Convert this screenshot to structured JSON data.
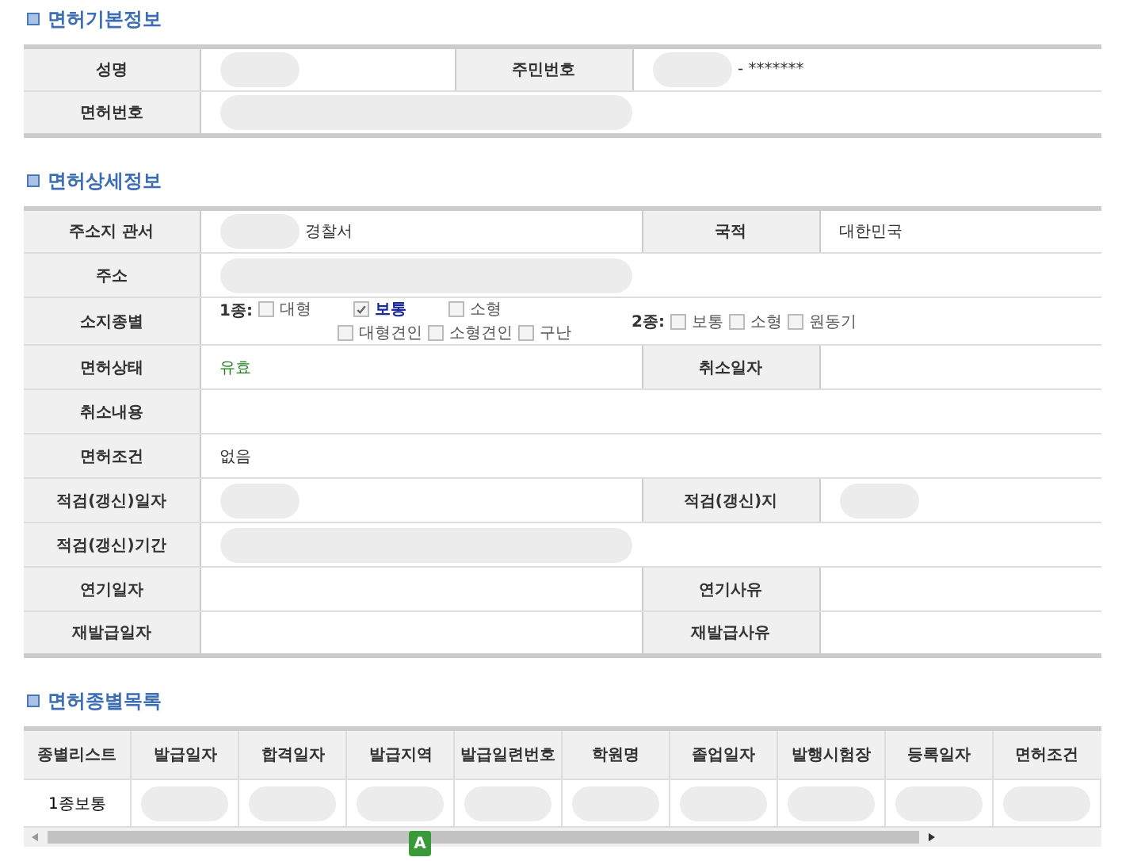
{
  "sections": [
    {
      "title": "면허기본정보",
      "kind": "form",
      "rows": [
        [
          {
            "kind": "label",
            "text": "성명"
          },
          {
            "kind": "value",
            "redacted": true
          },
          {
            "kind": "label",
            "text": "주민번호"
          },
          {
            "kind": "value",
            "text": "- *******",
            "redacted": true
          }
        ],
        [
          {
            "kind": "label",
            "text": "면허번호"
          },
          {
            "kind": "value",
            "redacted": true,
            "colspan": 3
          }
        ]
      ]
    },
    {
      "title": "면허상세정보",
      "kind": "form",
      "rows": [
        [
          {
            "kind": "label",
            "text": "주소지 관서"
          },
          {
            "kind": "value",
            "text": "경찰서",
            "redacted": true
          },
          {
            "kind": "label",
            "text": "국적"
          },
          {
            "kind": "value",
            "text": "대한민국"
          }
        ],
        [
          {
            "kind": "label",
            "text": "주소"
          },
          {
            "kind": "value",
            "redacted": true,
            "colspan": 3
          }
        ],
        [
          {
            "kind": "label",
            "text": "소지종별"
          },
          {
            "kind": "checks",
            "colspan": 3,
            "groups": [
              {
                "label": "1종:",
                "items": [
                  {
                    "text": "대형",
                    "checked": false
                  },
                  {
                    "text": "보통",
                    "checked": true
                  },
                  {
                    "text": "소형",
                    "checked": false
                  },
                  {
                    "text": "대형견인",
                    "checked": false
                  },
                  {
                    "text": "소형견인",
                    "checked": false
                  },
                  {
                    "text": "구난",
                    "checked": false
                  }
                ]
              },
              {
                "label": "2종:",
                "items": [
                  {
                    "text": "보통",
                    "checked": false
                  },
                  {
                    "text": "소형",
                    "checked": false
                  },
                  {
                    "text": "원동기",
                    "checked": false
                  }
                ]
              }
            ]
          }
        ],
        [
          {
            "kind": "label",
            "text": "면허상태"
          },
          {
            "kind": "status",
            "text": "유효"
          },
          {
            "kind": "label",
            "text": "취소일자"
          },
          {
            "kind": "value"
          }
        ],
        [
          {
            "kind": "label",
            "text": "취소내용"
          },
          {
            "kind": "value",
            "colspan": 3
          }
        ],
        [
          {
            "kind": "label",
            "text": "면허조건"
          },
          {
            "kind": "value",
            "text": "없음",
            "colspan": 3
          }
        ],
        [
          {
            "kind": "label",
            "text": "적검(갱신)일자"
          },
          {
            "kind": "value",
            "redacted": true
          },
          {
            "kind": "label",
            "text": "적검(갱신)지"
          },
          {
            "kind": "value",
            "redacted": true
          }
        ],
        [
          {
            "kind": "label",
            "text": "적검(갱신)기간"
          },
          {
            "kind": "value",
            "redacted": true,
            "colspan": 3
          }
        ],
        [
          {
            "kind": "label",
            "text": "연기일자"
          },
          {
            "kind": "value"
          },
          {
            "kind": "label",
            "text": "연기사유"
          },
          {
            "kind": "value"
          }
        ],
        [
          {
            "kind": "label",
            "text": "재발급일자"
          },
          {
            "kind": "value"
          },
          {
            "kind": "label",
            "text": "재발급사유"
          },
          {
            "kind": "value"
          }
        ]
      ]
    },
    {
      "title": "면허종별목록",
      "kind": "grid",
      "columns": [
        "종별리스트",
        "발급일자",
        "합격일자",
        "발급지역",
        "발급일련번호",
        "학원명",
        "졸업일자",
        "발행시험장",
        "등록일자",
        "면허조건"
      ],
      "rows": [
        [
          {
            "text": "1종보통"
          },
          {
            "redacted": true
          },
          {
            "redacted": true
          },
          {
            "redacted": true
          },
          {
            "redacted": true
          },
          {
            "redacted": true
          },
          {
            "redacted": true
          },
          {
            "redacted": true
          },
          {
            "redacted": true
          },
          {
            "redacted": true
          }
        ]
      ]
    }
  ],
  "overlay_badge": {
    "label": "A"
  }
}
